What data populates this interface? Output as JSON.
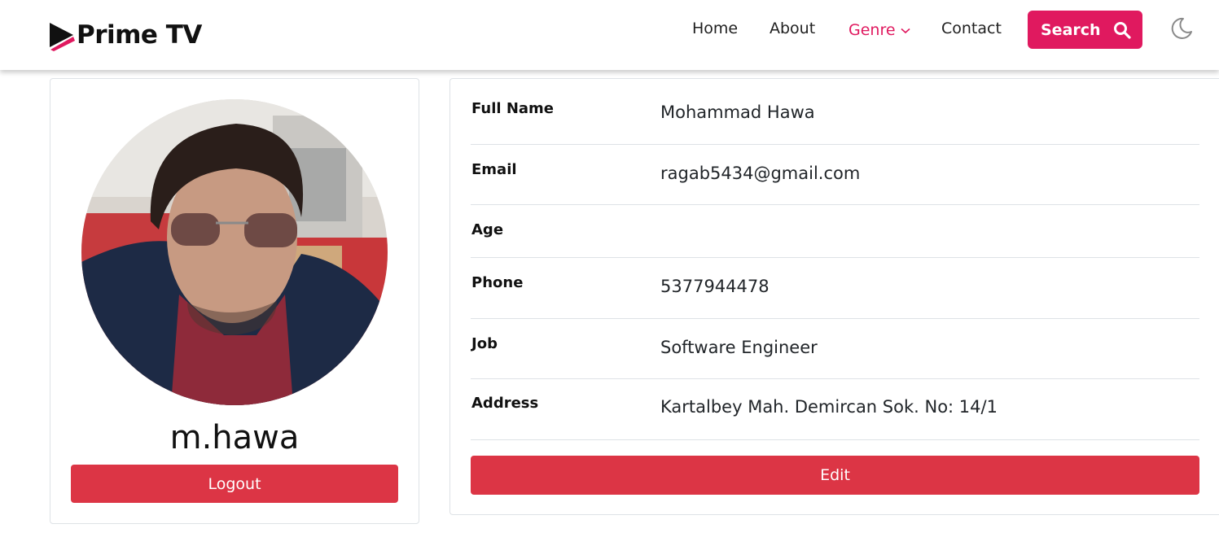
{
  "brand": {
    "name": "Prime TV"
  },
  "nav": {
    "home": "Home",
    "about": "About",
    "genre": "Genre",
    "contact": "Contact",
    "search_label": "Search"
  },
  "icons": {
    "brand": "play-logo-icon",
    "genre_dropdown": "chevron-down-icon",
    "search": "search-icon",
    "theme": "moon-icon"
  },
  "colors": {
    "accent": "#e0195f",
    "danger": "#dc3545",
    "border": "#dee2e6"
  },
  "profile": {
    "username": "m.hawa",
    "logout_label": "Logout"
  },
  "details": {
    "rows": [
      {
        "label": "Full Name",
        "value": "Mohammad Hawa"
      },
      {
        "label": "Email",
        "value": "ragab5434@gmail.com"
      },
      {
        "label": "Age",
        "value": ""
      },
      {
        "label": "Phone",
        "value": "5377944478"
      },
      {
        "label": "Job",
        "value": "Software Engineer"
      },
      {
        "label": "Address",
        "value": "Kartalbey Mah. Demircan Sok. No: 14/1"
      }
    ],
    "edit_label": "Edit"
  }
}
